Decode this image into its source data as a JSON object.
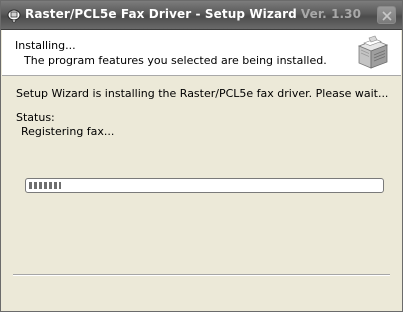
{
  "window": {
    "title": "Raster/PCL5e Fax Driver - Setup Wizard",
    "version": "Ver. 1.30"
  },
  "header": {
    "title": "Installing...",
    "subtitle": "The program features you selected are being installed."
  },
  "main": {
    "message": "Setup Wizard is installing the Raster/PCL5e fax driver. Please wait...",
    "status_label": "Status:",
    "status_value": "Registering fax...",
    "progress_fraction": 0.09
  },
  "icons": {
    "title": "printer-icon",
    "header": "printer-graphic-icon",
    "close": "close-icon"
  },
  "colors": {
    "titlebar": "#5a5a5a",
    "dialog_bg": "#ece9d8",
    "progress_fill": "#6e6e6e"
  }
}
